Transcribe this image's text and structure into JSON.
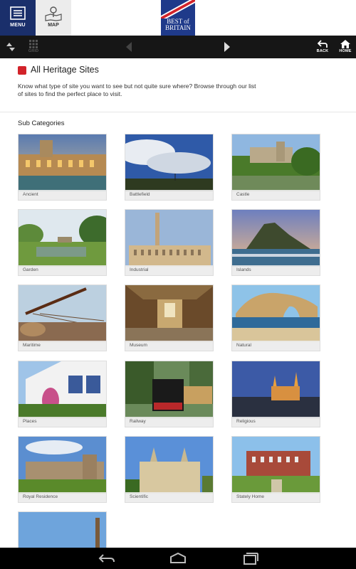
{
  "header": {
    "menu_label": "MENU",
    "map_label": "MAP",
    "logo_text_1": "BEST of",
    "logo_text_2": "BRITAIN"
  },
  "toolbar": {
    "grid_label": "GRID",
    "back_label": "BACK",
    "home_label": "HOME"
  },
  "page": {
    "title": "All Heritage Sites",
    "description": "Know what type of site you want to see but not quite sure where? Browse through our list of sites to find the perfect place to visit.",
    "subcategories_title": "Sub Categories"
  },
  "categories": [
    {
      "label": "Ancient"
    },
    {
      "label": "Battlefield"
    },
    {
      "label": "Castle"
    },
    {
      "label": "Garden"
    },
    {
      "label": "Industrial"
    },
    {
      "label": "Islands"
    },
    {
      "label": "Maritime"
    },
    {
      "label": "Museum"
    },
    {
      "label": "Natural"
    },
    {
      "label": "Places"
    },
    {
      "label": "Railway"
    },
    {
      "label": "Religious"
    },
    {
      "label": "Royal Residence"
    },
    {
      "label": "Scientific"
    },
    {
      "label": "Stately Home"
    },
    {
      "label": ""
    }
  ],
  "colors": {
    "brand_navy": "#1a2f6b",
    "accent_red": "#d2232a",
    "toolbar_bg": "#161616"
  },
  "icons": {
    "menu": "menu-icon",
    "map": "map-icon",
    "sort": "sort-arrows-icon",
    "grid": "grid-icon",
    "previous": "arrow-left-icon",
    "next": "arrow-right-icon",
    "back": "back-icon",
    "home": "home-icon",
    "nav_back": "android-back-icon",
    "nav_home": "android-home-icon",
    "nav_recents": "android-recents-icon"
  }
}
